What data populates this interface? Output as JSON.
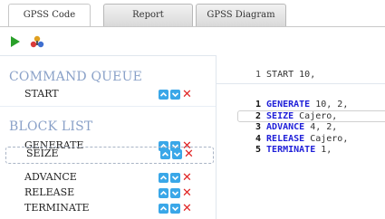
{
  "tabs": [
    {
      "label": "GPSS Code",
      "active": true
    },
    {
      "label": "Report",
      "active": false
    },
    {
      "label": "GPSS Diagram",
      "active": false
    }
  ],
  "toolbar": {
    "run_icon": "play-icon",
    "debug_icon": "debug-icon"
  },
  "command_queue": {
    "title": "COMMAND QUEUE",
    "items": [
      {
        "label": "START"
      }
    ]
  },
  "block_list": {
    "title": "BLOCK LIST",
    "items": [
      {
        "label": "GENERATE"
      },
      {
        "label": "SEIZE"
      },
      {
        "label": "ADVANCE"
      },
      {
        "label": "RELEASE"
      },
      {
        "label": "TERMINATE"
      }
    ]
  },
  "queue_code": {
    "num": "1",
    "text": "START 10,"
  },
  "code_lines": [
    {
      "num": "1",
      "keyword": "GENERATE",
      "args": " 10, 2,"
    },
    {
      "num": "2",
      "keyword": "SEIZE",
      "args": " Cajero,"
    },
    {
      "num": "3",
      "keyword": "ADVANCE",
      "args": " 4, 2,"
    },
    {
      "num": "4",
      "keyword": "RELEASE",
      "args": " Cajero,"
    },
    {
      "num": "5",
      "keyword": "TERMINATE",
      "args": " 1,"
    }
  ],
  "colors": {
    "accent": "#3aa7e8",
    "delete": "#e02424",
    "keyword": "#1f1fd8",
    "section_title": "#8aa1c8",
    "run": "#2aa02a"
  }
}
